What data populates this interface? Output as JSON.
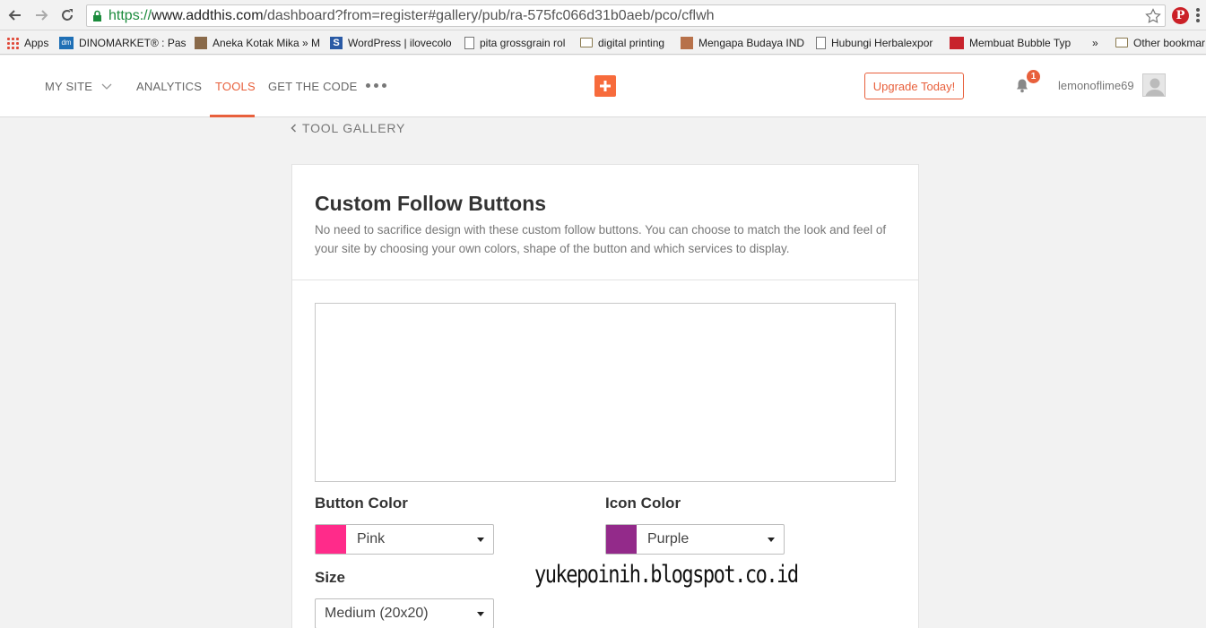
{
  "browser": {
    "url_scheme": "https://",
    "url_host": "www.addthis.com",
    "url_path": "/dashboard?from=register#gallery/pub/ra-575fc066d31b0aeb/pco/cflwh",
    "bookmarks": [
      {
        "label": "Apps",
        "icon": "apps-grid-icon"
      },
      {
        "label": "DINOMARKET® : Pas",
        "icon": "dm-favicon"
      },
      {
        "label": "Aneka Kotak Mika » M",
        "icon": "site-favicon"
      },
      {
        "label": "WordPress | ilovecolo",
        "icon": "wordpress-favicon"
      },
      {
        "label": "pita grossgrain rol",
        "icon": "page-icon"
      },
      {
        "label": "digital printing",
        "icon": "folder-icon"
      },
      {
        "label": "Mengapa Budaya IND",
        "icon": "site-favicon"
      },
      {
        "label": "Hubungi Herbalexpor",
        "icon": "page-icon"
      },
      {
        "label": "Membuat Bubble Typ",
        "icon": "idsn-favicon"
      },
      {
        "label": "»",
        "icon": "overflow-chevron-icon"
      },
      {
        "label": "Other bookmar",
        "icon": "folder-icon"
      }
    ]
  },
  "header": {
    "nav": [
      {
        "label": "MY SITE"
      },
      {
        "label": "ANALYTICS"
      },
      {
        "label": "TOOLS"
      },
      {
        "label": "GET THE CODE"
      }
    ],
    "upgrade_label": "Upgrade Today!",
    "notification_count": "1",
    "username": "lemonoflime69",
    "accent_color": "#e8603c"
  },
  "content": {
    "back_label": "TOOL GALLERY",
    "title": "Custom Follow Buttons",
    "description": "No need to sacrifice design with these custom follow buttons. You can choose to match the look and feel of your site by choosing your own colors, shape of the button and which services to display.",
    "button_color": {
      "label": "Button Color",
      "value": "Pink",
      "swatch": "#ff2b8a"
    },
    "icon_color": {
      "label": "Icon Color",
      "value": "Purple",
      "swatch": "#932a8a"
    },
    "size": {
      "label": "Size",
      "value": "Medium (20x20)"
    }
  },
  "watermark": "yukepoinih.blogspot.co.id"
}
